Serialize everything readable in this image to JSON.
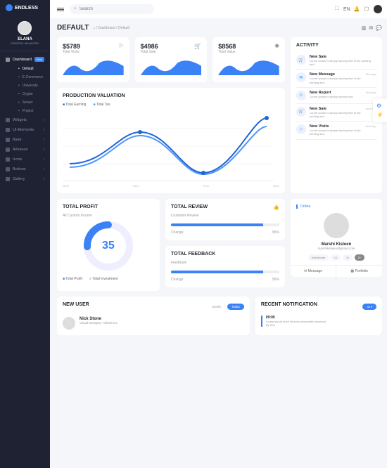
{
  "brand": "ENDLESS",
  "profile": {
    "name": "ELANA",
    "role": "General Manager."
  },
  "nav": {
    "dashboard": {
      "label": "Dashboard",
      "badge": "New"
    },
    "sub": [
      "Default",
      "E-Commerce",
      "University",
      "Crypto",
      "Server",
      "Project"
    ],
    "items": [
      "Widgets",
      "UI-Elements",
      "Base",
      "Advance",
      "Icons",
      "Buttons",
      "Gallery"
    ]
  },
  "search": {
    "placeholder": "Search"
  },
  "lang": "EN",
  "page": {
    "title": "DEFAULT",
    "crumb": "⌂ / Dashboard / Default"
  },
  "stats": [
    {
      "value": "$5789",
      "label": "Total Visits",
      "icon": "⚐"
    },
    {
      "value": "$4986",
      "label": "Total Sale",
      "icon": "🛒"
    },
    {
      "value": "$8568",
      "label": "Total Value",
      "icon": "✺"
    }
  ],
  "activity": {
    "title": "ACTIVITY",
    "items": [
      {
        "icon": "🛒",
        "title": "New Sale",
        "desc": "Lorem Ipsum is simply dummy text of the printing and",
        "time": ""
      },
      {
        "icon": "✉",
        "title": "New Message",
        "desc": "Lorem Ipsum is simply dummy text of the printing and",
        "time": "14m Ago"
      },
      {
        "icon": "⚠",
        "title": "New Report",
        "desc": "Lorem Ipsum is simply dummy text",
        "time": "14m Ago"
      },
      {
        "icon": "🛒",
        "title": "New Sale",
        "desc": "Lorem Ipsum is simply dummy text of the printing and",
        "time": "14m Ago"
      },
      {
        "icon": "⚐",
        "title": "New Visits",
        "desc": "Lorem Ipsum is simply dummy text of the printing and",
        "time": "14m Ago"
      }
    ]
  },
  "production": {
    "title": "PRODUCTION VALUATION",
    "legend": [
      "Total Earning",
      "Total Tax"
    ],
    "xlabels": [
      "2009",
      "2010",
      "2011",
      "2012"
    ]
  },
  "profit": {
    "title": "TOTAL PROFIT",
    "sub": "All Custom Income",
    "value": "35",
    "legend": [
      "Total Profit",
      "Total Investment"
    ]
  },
  "review": {
    "title": "TOTAL REVIEW",
    "sub": "Customer Review",
    "change": "Change",
    "pct": "95%"
  },
  "feedback": {
    "title": "TOTAL FEEDBACK",
    "sub": "Feedback",
    "change": "Change",
    "pct": "95%"
  },
  "user": {
    "status": "Online",
    "name": "Marshi Kisteen",
    "email": "marshikisteen@gmail.com",
    "chips": [
      "Dashboard",
      "Ui",
      "Xi",
      "2+"
    ],
    "btn1": "Message",
    "btn2": "Portfolio"
  },
  "newuser": {
    "title": "NEW USER",
    "tabs": [
      "Month",
      "Today"
    ],
    "name": "Nick Stone",
    "role": "Visual Designer, Github Inc"
  },
  "notif": {
    "title": "RECENT NOTIFICATION",
    "pill": "All ▾",
    "time": "09:00",
    "txt": "Lorem ipsum dolor sit amit,consectetur eiusmdd.",
    "by": "By Kan"
  },
  "chart_data": {
    "type": "line",
    "x": [
      2009,
      2010,
      2011,
      2012
    ],
    "series": [
      {
        "name": "Total Earning",
        "values": [
          25,
          70,
          15,
          90
        ]
      },
      {
        "name": "Total Tax",
        "values": [
          20,
          65,
          12,
          78
        ]
      }
    ],
    "ylim": [
      0,
      100
    ]
  }
}
